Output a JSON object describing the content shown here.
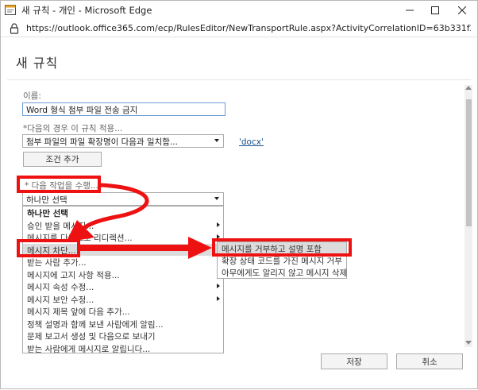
{
  "window": {
    "title": "새 규칙 - 개인 - Microsoft Edge",
    "url": "https://outlook.office365.com/ecp/RulesEditor/NewTransportRule.aspx?ActivityCorrelationID=63b331f2-6de7-1ce..."
  },
  "page": {
    "title": "새 규칙"
  },
  "form": {
    "name_label": "이름:",
    "name_value": "Word 형식 첨부 파일 전송 금지",
    "condition_label": "*다음의 경우 이 규칙 적용...",
    "condition_value": "첨부 파일의 파일 확장명이 다음과 일치함...",
    "condition_link": "'docx'",
    "add_condition_label": "조건 추가",
    "action_label": "* 다음 작업을 수행...",
    "action_value": "하나만 선택"
  },
  "dropdown": {
    "items": [
      {
        "label": "하나만 선택"
      },
      {
        "label": "승인 받을 메시지..."
      },
      {
        "label": "메시지를 다음으로 리디렉션..."
      },
      {
        "label": "메시지 차단..."
      },
      {
        "label": "받는 사람 추가..."
      },
      {
        "label": "메시지에 고지 사항 적용..."
      },
      {
        "label": "메시지 속성 수정..."
      },
      {
        "label": "메시지 보안 수정..."
      },
      {
        "label": "메시지 제목 앞에 다음 추가..."
      },
      {
        "label": "정책 설명과 함께 보낸 사람에게 알림..."
      },
      {
        "label": "문제 보고서 생성 및 다음으로 보내기"
      },
      {
        "label": "받는 사람에게 메시지로 알립니다..."
      }
    ]
  },
  "submenu": {
    "items": [
      {
        "label": "메시지를 거부하고 설명 포함"
      },
      {
        "label": "확장 상태 코드를 가진 메시지 거부"
      },
      {
        "label": "아무에게도 알리지 않고 메시지 삭제"
      }
    ]
  },
  "footer": {
    "save_label": "저장",
    "cancel_label": "취소"
  },
  "colors": {
    "annotation": "#ee1111",
    "link": "#1a4f8f",
    "textbox_border": "#6a9bd6"
  }
}
